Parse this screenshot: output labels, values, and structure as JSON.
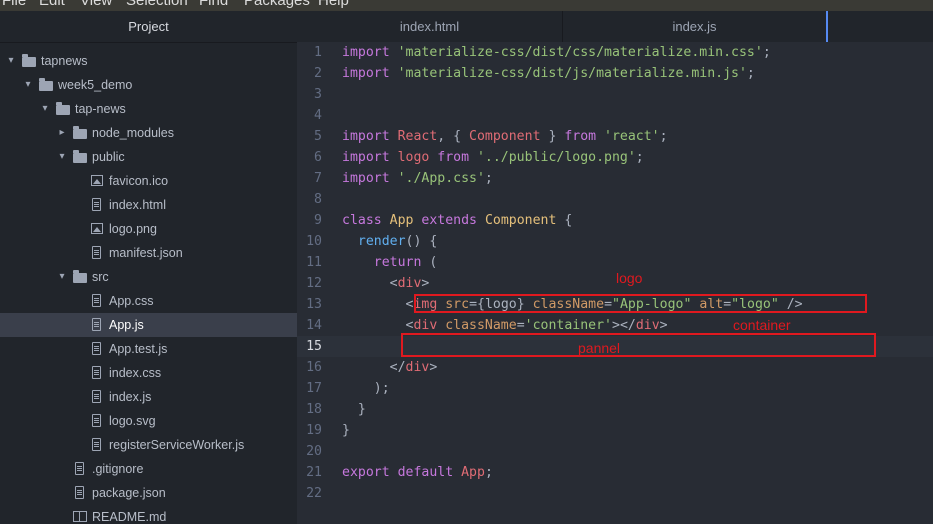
{
  "menu": [
    "File",
    "Edit",
    "View",
    "Selection",
    "Find",
    "Packages",
    "Help"
  ],
  "sidebar": {
    "title": "Project",
    "tree": [
      {
        "label": "tapnews",
        "type": "folder",
        "depth": 0,
        "open": true
      },
      {
        "label": "week5_demo",
        "type": "folder",
        "depth": 1,
        "open": true
      },
      {
        "label": "tap-news",
        "type": "folder",
        "depth": 2,
        "open": true
      },
      {
        "label": "node_modules",
        "type": "folder",
        "depth": 3,
        "open": false
      },
      {
        "label": "public",
        "type": "folder",
        "depth": 3,
        "open": true
      },
      {
        "label": "favicon.ico",
        "type": "image",
        "depth": 4
      },
      {
        "label": "index.html",
        "type": "file",
        "depth": 4
      },
      {
        "label": "logo.png",
        "type": "image",
        "depth": 4
      },
      {
        "label": "manifest.json",
        "type": "file",
        "depth": 4
      },
      {
        "label": "src",
        "type": "folder",
        "depth": 3,
        "open": true
      },
      {
        "label": "App.css",
        "type": "file",
        "depth": 4
      },
      {
        "label": "App.js",
        "type": "file",
        "depth": 4,
        "selected": true
      },
      {
        "label": "App.test.js",
        "type": "file",
        "depth": 4
      },
      {
        "label": "index.css",
        "type": "file",
        "depth": 4
      },
      {
        "label": "index.js",
        "type": "file",
        "depth": 4
      },
      {
        "label": "logo.svg",
        "type": "file",
        "depth": 4
      },
      {
        "label": "registerServiceWorker.js",
        "type": "file",
        "depth": 4
      },
      {
        "label": ".gitignore",
        "type": "file",
        "depth": 3
      },
      {
        "label": "package.json",
        "type": "file",
        "depth": 3
      },
      {
        "label": "README.md",
        "type": "book",
        "depth": 3
      }
    ]
  },
  "tabs": [
    {
      "label": "index.html",
      "active": false
    },
    {
      "label": "index.js",
      "active": true
    }
  ],
  "editor": {
    "cursor_line": 15,
    "lines": [
      [
        [
          "kw",
          "import "
        ],
        [
          "str",
          "'materialize-css/dist/css/materialize.min.css'"
        ],
        [
          "plain",
          ";"
        ]
      ],
      [
        [
          "kw",
          "import "
        ],
        [
          "str",
          "'materialize-css/dist/js/materialize.min.js'"
        ],
        [
          "plain",
          ";"
        ]
      ],
      [],
      [],
      [
        [
          "kw",
          "import "
        ],
        [
          "def",
          "React"
        ],
        [
          "plain",
          ", { "
        ],
        [
          "def",
          "Component"
        ],
        [
          "plain",
          " } "
        ],
        [
          "kw",
          "from "
        ],
        [
          "str",
          "'react'"
        ],
        [
          "plain",
          ";"
        ]
      ],
      [
        [
          "kw",
          "import "
        ],
        [
          "def",
          "logo "
        ],
        [
          "kw",
          "from "
        ],
        [
          "str",
          "'../public/logo.png'"
        ],
        [
          "plain",
          ";"
        ]
      ],
      [
        [
          "kw",
          "import "
        ],
        [
          "str",
          "'./App.css'"
        ],
        [
          "plain",
          ";"
        ]
      ],
      [],
      [
        [
          "kw",
          "class "
        ],
        [
          "cls",
          "App "
        ],
        [
          "kw",
          "extends "
        ],
        [
          "cls",
          "Component"
        ],
        [
          "plain",
          " {"
        ]
      ],
      [
        [
          "plain",
          "  "
        ],
        [
          "fn",
          "render"
        ],
        [
          "plain",
          "() {"
        ]
      ],
      [
        [
          "plain",
          "    "
        ],
        [
          "kw",
          "return"
        ],
        [
          "plain",
          " ("
        ]
      ],
      [
        [
          "plain",
          "      <"
        ],
        [
          "tag",
          "div"
        ],
        [
          "plain",
          ">"
        ]
      ],
      [
        [
          "plain",
          "        <"
        ],
        [
          "tag",
          "img "
        ],
        [
          "attr",
          "src"
        ],
        [
          "plain",
          "={logo} "
        ],
        [
          "attr",
          "className"
        ],
        [
          "plain",
          "="
        ],
        [
          "str",
          "\"App-logo\""
        ],
        [
          "plain",
          " "
        ],
        [
          "attr",
          "alt"
        ],
        [
          "plain",
          "="
        ],
        [
          "str",
          "\"logo\""
        ],
        [
          "plain",
          " />"
        ]
      ],
      [
        [
          "plain",
          "        <"
        ],
        [
          "tag",
          "div "
        ],
        [
          "attr",
          "className"
        ],
        [
          "plain",
          "="
        ],
        [
          "str",
          "'container'"
        ],
        [
          "plain",
          "></"
        ],
        [
          "tag",
          "div"
        ],
        [
          "plain",
          ">"
        ]
      ],
      [],
      [
        [
          "plain",
          "      </"
        ],
        [
          "tag",
          "div"
        ],
        [
          "plain",
          ">"
        ]
      ],
      [
        [
          "plain",
          "    );"
        ]
      ],
      [
        [
          "plain",
          "  }"
        ]
      ],
      [
        [
          "plain",
          "}"
        ]
      ],
      [],
      [
        [
          "kw",
          "export "
        ],
        [
          "kw",
          "default "
        ],
        [
          "def",
          "App"
        ],
        [
          "plain",
          ";"
        ]
      ],
      []
    ]
  },
  "annotations": [
    {
      "label": "logo",
      "color": "#e0191f"
    },
    {
      "label": "container",
      "color": "#e0191f"
    },
    {
      "label": "pannel",
      "color": "#e0191f"
    }
  ]
}
